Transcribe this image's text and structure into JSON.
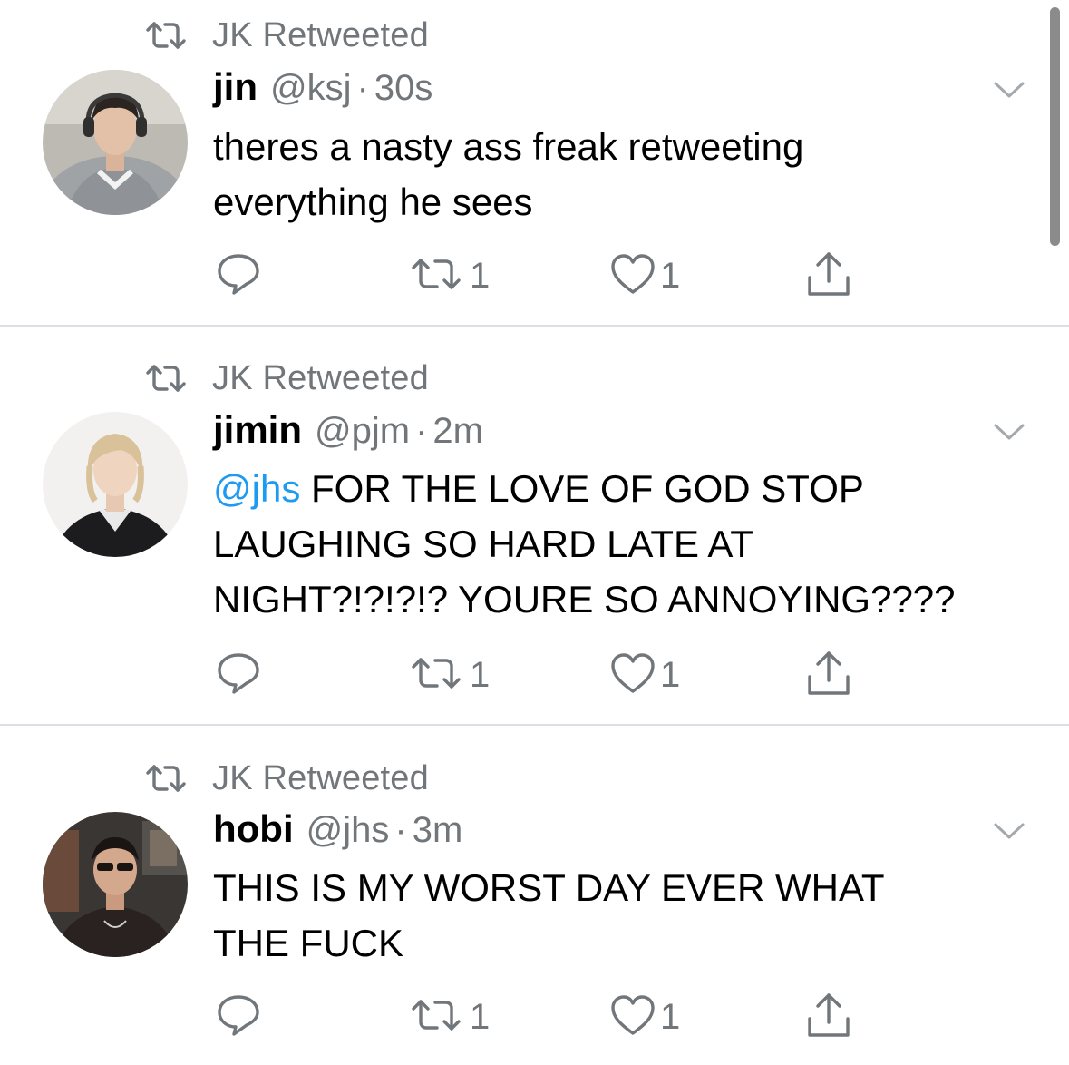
{
  "colors": {
    "text_primary": "#000000",
    "text_secondary": "#71767b",
    "mention": "#1d9bf0",
    "divider": "#dcdfe3"
  },
  "icons": {
    "retweet_context": "retweet-icon",
    "caret": "chevron-down-icon",
    "reply": "reply-icon",
    "retweet": "retweet-icon",
    "like": "heart-icon",
    "share": "share-icon"
  },
  "tweets": [
    {
      "retweeted_by": "JK Retweeted",
      "display_name": "jin",
      "handle": "@ksj",
      "separator": "·",
      "timestamp": "30s",
      "text_lines": [
        {
          "mention": "",
          "text": "theres a nasty ass freak retweeting"
        },
        {
          "mention": "",
          "text": "everything he sees"
        }
      ],
      "retweet_count": "1",
      "like_count": "1"
    },
    {
      "retweeted_by": "JK Retweeted",
      "display_name": "jimin",
      "handle": "@pjm",
      "separator": "·",
      "timestamp": "2m",
      "text_lines": [
        {
          "mention": "@jhs",
          "text": " FOR THE LOVE OF GOD STOP"
        },
        {
          "mention": "",
          "text": "LAUGHING SO HARD LATE AT"
        },
        {
          "mention": "",
          "text": "NIGHT?!?!?!? YOURE SO ANNOYING????"
        }
      ],
      "retweet_count": "1",
      "like_count": "1"
    },
    {
      "retweeted_by": "JK Retweeted",
      "display_name": "hobi",
      "handle": "@jhs",
      "separator": "·",
      "timestamp": "3m",
      "text_lines": [
        {
          "mention": "",
          "text": "THIS IS MY WORST DAY EVER WHAT"
        },
        {
          "mention": "",
          "text": "THE FUCK"
        }
      ],
      "retweet_count": "1",
      "like_count": "1"
    }
  ]
}
